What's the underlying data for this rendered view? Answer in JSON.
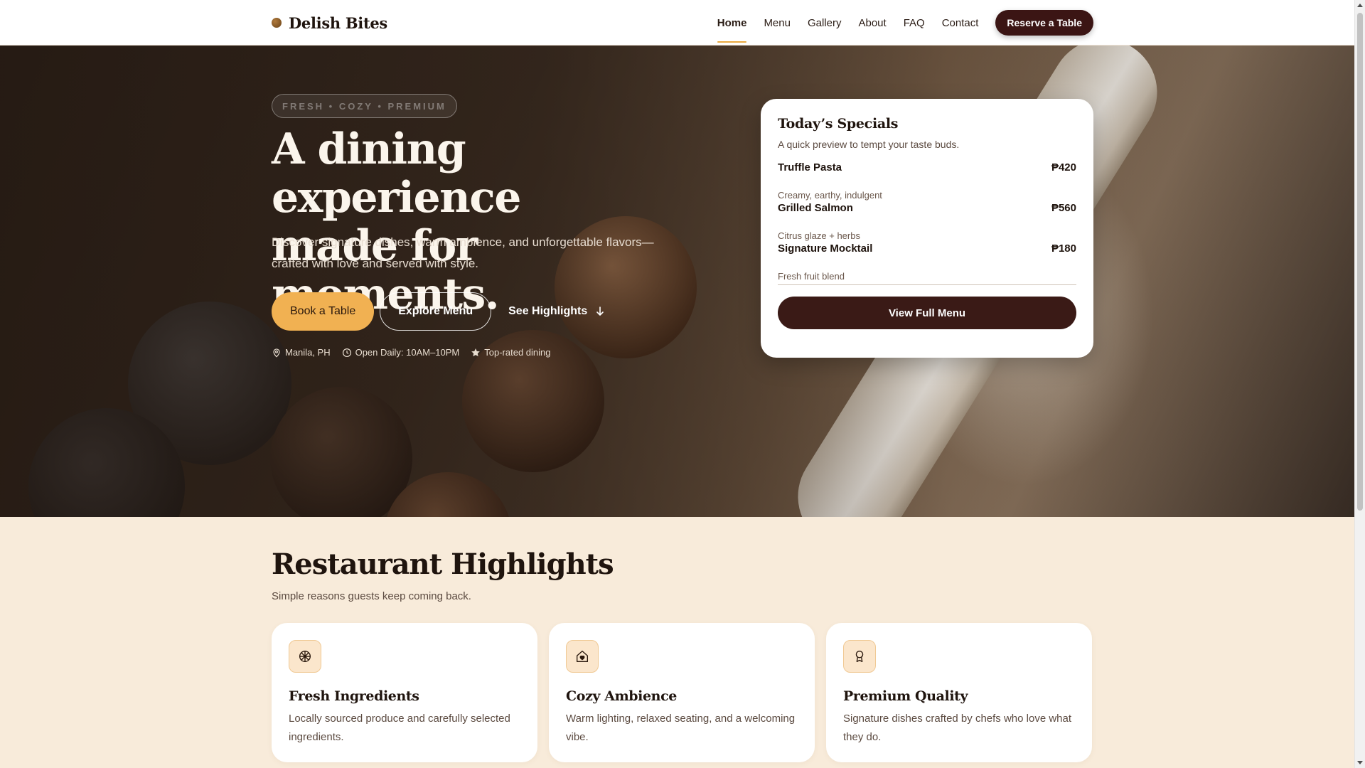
{
  "nav": {
    "brand": "Delish Bites",
    "links": [
      "Home",
      "Menu",
      "Gallery",
      "About",
      "FAQ",
      "Contact"
    ],
    "cta": "Reserve a Table"
  },
  "hero": {
    "tag": "FRESH • COZY • PREMIUM",
    "title_line1": "A dining experience",
    "title_line2": "made for moments.",
    "subtitle": "Discover signature dishes, warm ambience, and unforgettable flavors—crafted with love and served with style.",
    "buttons": {
      "primary": "Book a Table",
      "secondary": "Explore Menu",
      "link": "See Highlights"
    },
    "meta": {
      "location": "Manila, PH",
      "hours": "Open Daily: 10AM–10PM",
      "rating": "Top-rated dining"
    }
  },
  "specials": {
    "title": "Today’s Specials",
    "subtitle": "A quick preview to tempt your taste buds.",
    "items": [
      {
        "name": "Truffle Pasta",
        "price": "₱420",
        "desc": "Creamy, earthy, indulgent"
      },
      {
        "name": "Grilled Salmon",
        "price": "₱560",
        "desc": "Citrus glaze + herbs"
      },
      {
        "name": "Signature Mocktail",
        "price": "₱180",
        "desc": "Fresh fruit blend"
      }
    ],
    "button": "View Full Menu"
  },
  "highlights": {
    "title": "Restaurant Highlights",
    "subtitle": "Simple reasons guests keep coming back.",
    "cards": [
      {
        "title": "Fresh Ingredients",
        "text": "Locally sourced produce and carefully selected ingredients.",
        "icon": "produce-icon"
      },
      {
        "title": "Cozy Ambience",
        "text": "Warm lighting, relaxed seating, and a welcoming vibe.",
        "icon": "home-heart-icon"
      },
      {
        "title": "Premium Quality",
        "text": "Signature dishes crafted by chefs who love what they do.",
        "icon": "award-icon"
      }
    ]
  },
  "colors": {
    "accent": "#f1b152",
    "brand_dark": "#3b1514",
    "section_bg": "#f8ebda"
  }
}
